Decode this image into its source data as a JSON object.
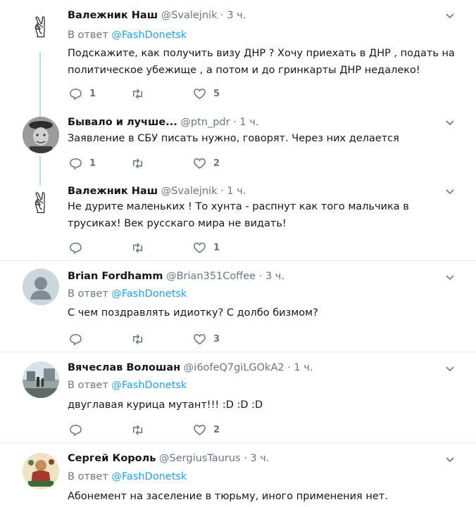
{
  "tweets": [
    {
      "name": "Валежник Наш",
      "handle": "@Svalejnik",
      "dot": "·",
      "time": "3 ч.",
      "reply_prefix": "В ответ",
      "reply_to": "@FashDonetsk",
      "text": "Подскажите, как получить визу ДНР ? Хочу приехать в ДНР , подать на политическое убежище , а потом и до гринкарты ДНР недалеко!",
      "replies": "1",
      "retweets": "",
      "likes": "5",
      "avatar_icon": "victory-hand-emoji"
    },
    {
      "name": "Бывало и лучше...",
      "handle": "@ptn_pdr",
      "dot": "·",
      "time": "1 ч.",
      "text": "Заявление в СБУ писать нужно, говорят. Через них делается",
      "replies": "1",
      "retweets": "",
      "likes": "2",
      "avatar_icon": "bw-photo-avatar"
    },
    {
      "name": "Валежник Наш",
      "handle": "@Svalejnik",
      "dot": "·",
      "time": "1 ч.",
      "text": "Не дурите маленьких ! То хунта - распнут как того мальчика в трусиках! Век русскаго мира не видать!",
      "replies": "",
      "retweets": "",
      "likes": "1",
      "avatar_icon": "victory-hand-emoji"
    },
    {
      "name": "Brian Fordhamm",
      "handle": "@Brian351Coffee",
      "dot": "·",
      "time": "3 ч.",
      "reply_prefix": "В ответ",
      "reply_to": "@FashDonetsk",
      "text": "С чем поздравлять идиотку? С долбо  бизмом?",
      "replies": "",
      "retweets": "",
      "likes": "3",
      "avatar_icon": "default-avatar"
    },
    {
      "name": "Вячеслав Волошан",
      "handle": "@i6ofeQ7giLGOkA2",
      "dot": "·",
      "time": "1 ч.",
      "reply_prefix": "В ответ",
      "reply_to": "@FashDonetsk",
      "text": "двуглавая курица мутант!!! :D :D :D",
      "replies": "",
      "retweets": "",
      "likes": "2",
      "avatar_icon": "street-photo-avatar"
    },
    {
      "name": "Сергей Король",
      "handle": "@SergiusTaurus",
      "dot": "·",
      "time": "3 ч.",
      "reply_prefix": "В ответ",
      "reply_to": "@FashDonetsk",
      "text": "Абонемент на заселение в тюрьму, иного применения нет.",
      "avatar_icon": "illustration-avatar"
    }
  ],
  "icons": {
    "reply": "reply-icon",
    "retweet": "retweet-icon",
    "like": "heart-icon",
    "menu": "chevron-down-icon"
  },
  "colors": {
    "link": "#1da1f2",
    "muted": "#657786",
    "thread": "#b8dbef",
    "divider": "#e6ecf0"
  }
}
